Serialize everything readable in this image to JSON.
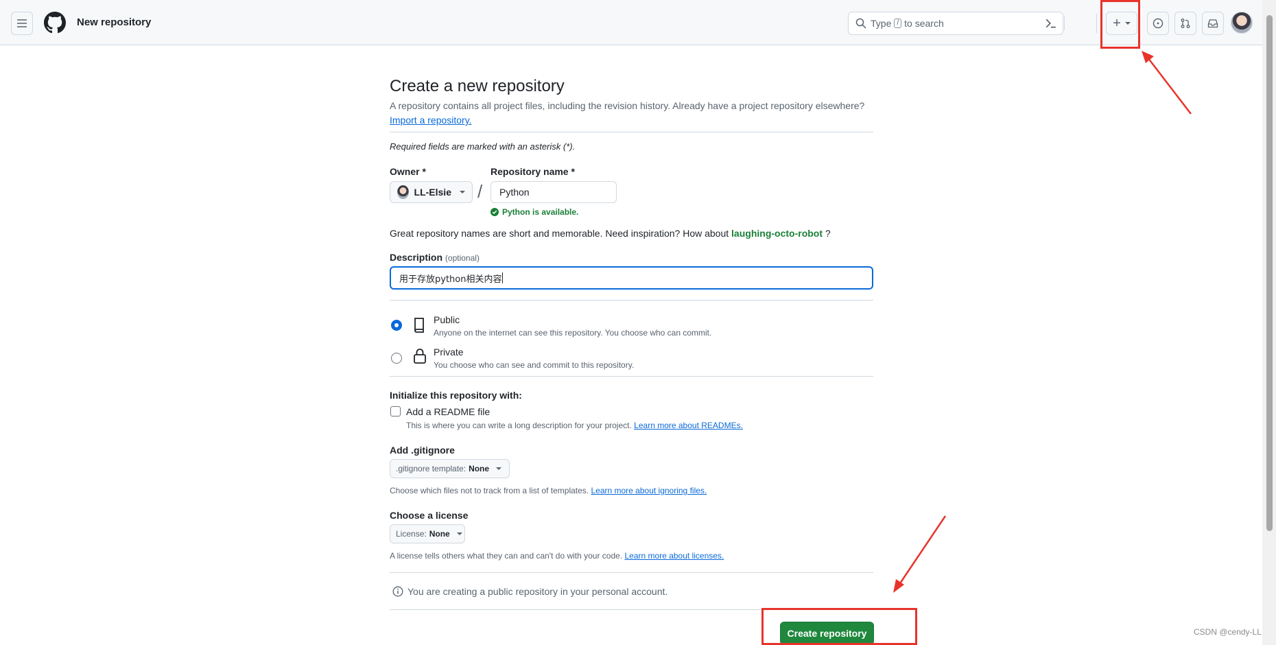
{
  "header": {
    "title": "New repository",
    "search_prefix": "Type",
    "search_key": "/",
    "search_suffix": "to search",
    "new_button_label": "+"
  },
  "form": {
    "heading": "Create a new repository",
    "intro": "A repository contains all project files, including the revision history. Already have a project repository elsewhere?",
    "import_link": "Import a repository.",
    "required_note": "Required fields are marked with an asterisk (*).",
    "owner_label": "Owner *",
    "owner_value": "LL-Elsie",
    "slash": "/",
    "repo_name_label": "Repository name *",
    "repo_name_value": "Python",
    "available_text": "Python is available.",
    "inspiration_text": "Great repository names are short and memorable. Need inspiration? How about",
    "inspiration_suggestion": "laughing-octo-robot",
    "inspiration_end": "?",
    "description_label": "Description",
    "description_optional": "(optional)",
    "description_value": "用于存放python相关内容",
    "visibility": [
      {
        "label": "Public",
        "desc": "Anyone on the internet can see this repository. You choose who can commit.",
        "selected": true
      },
      {
        "label": "Private",
        "desc": "You choose who can see and commit to this repository.",
        "selected": false
      }
    ],
    "init_heading": "Initialize this repository with:",
    "readme_label": "Add a README file",
    "readme_desc": "This is where you can write a long description for your project.",
    "readme_link": "Learn more about READMEs.",
    "gitignore_label": "Add .gitignore",
    "gitignore_select_prefix": ".gitignore template:",
    "gitignore_select_value": "None",
    "gitignore_desc": "Choose which files not to track from a list of templates.",
    "gitignore_link": "Learn more about ignoring files.",
    "license_label": "Choose a license",
    "license_select_prefix": "License:",
    "license_select_value": "None",
    "license_desc": "A license tells others what they can and can't do with your code.",
    "license_link": "Learn more about licenses.",
    "notice": "You are creating a public repository in your personal account.",
    "create_button": "Create repository"
  },
  "watermark": "CSDN @cendy-LL",
  "colors": {
    "accent": "#0969da",
    "success": "#1a7f37",
    "primary_button": "#1f883d",
    "annotation": "#e8332b"
  }
}
